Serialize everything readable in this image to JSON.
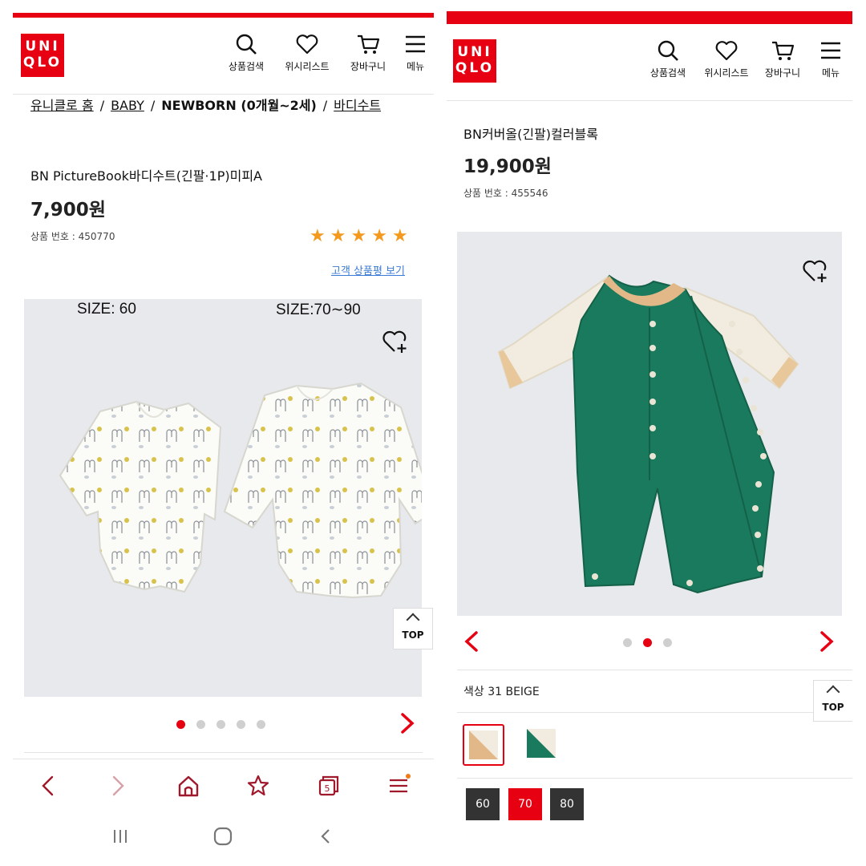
{
  "left": {
    "header": {
      "logo": "UNIQLO",
      "search_label": "상품검색",
      "wishlist_label": "위시리스트",
      "cart_label": "장바구니",
      "menu_label": "메뉴"
    },
    "breadcrumb": [
      "유니클로 홈",
      "BABY",
      "NEWBORN (0개월~2세)",
      "바디수트"
    ],
    "product": {
      "name": "BN PictureBook바디수트(긴팔·1P)미피A",
      "price": "7,900원",
      "number_label": "상품 번호 : 450770",
      "rating": 5,
      "review_link": "고객 상품평 보기"
    },
    "image": {
      "size_label_1": "SIZE: 60",
      "size_label_2": "SIZE:70∼90",
      "carousel_total": 5,
      "carousel_active": 1
    },
    "top_button": "TOP",
    "colors": {
      "accent": "#e60012",
      "star": "#f39a1e",
      "link": "#3b7bd6"
    }
  },
  "right": {
    "header": {
      "logo": "UNIQLO",
      "search_label": "상품검색",
      "wishlist_label": "위시리스트",
      "cart_label": "장바구니",
      "menu_label": "메뉴"
    },
    "product": {
      "name": "BN커버올(긴팔)컬러블록",
      "price": "19,900원",
      "number_label": "상품 번호 : 455546"
    },
    "image": {
      "carousel_total": 3,
      "carousel_active": 2
    },
    "color_label": "색상 31 BEIGE",
    "swatches": [
      {
        "name": "beige",
        "selected": true
      },
      {
        "name": "green",
        "selected": false
      }
    ],
    "sizes": [
      {
        "label": "60",
        "selected": false
      },
      {
        "label": "70",
        "selected": true
      },
      {
        "label": "80",
        "selected": false
      }
    ],
    "top_button": "TOP"
  }
}
